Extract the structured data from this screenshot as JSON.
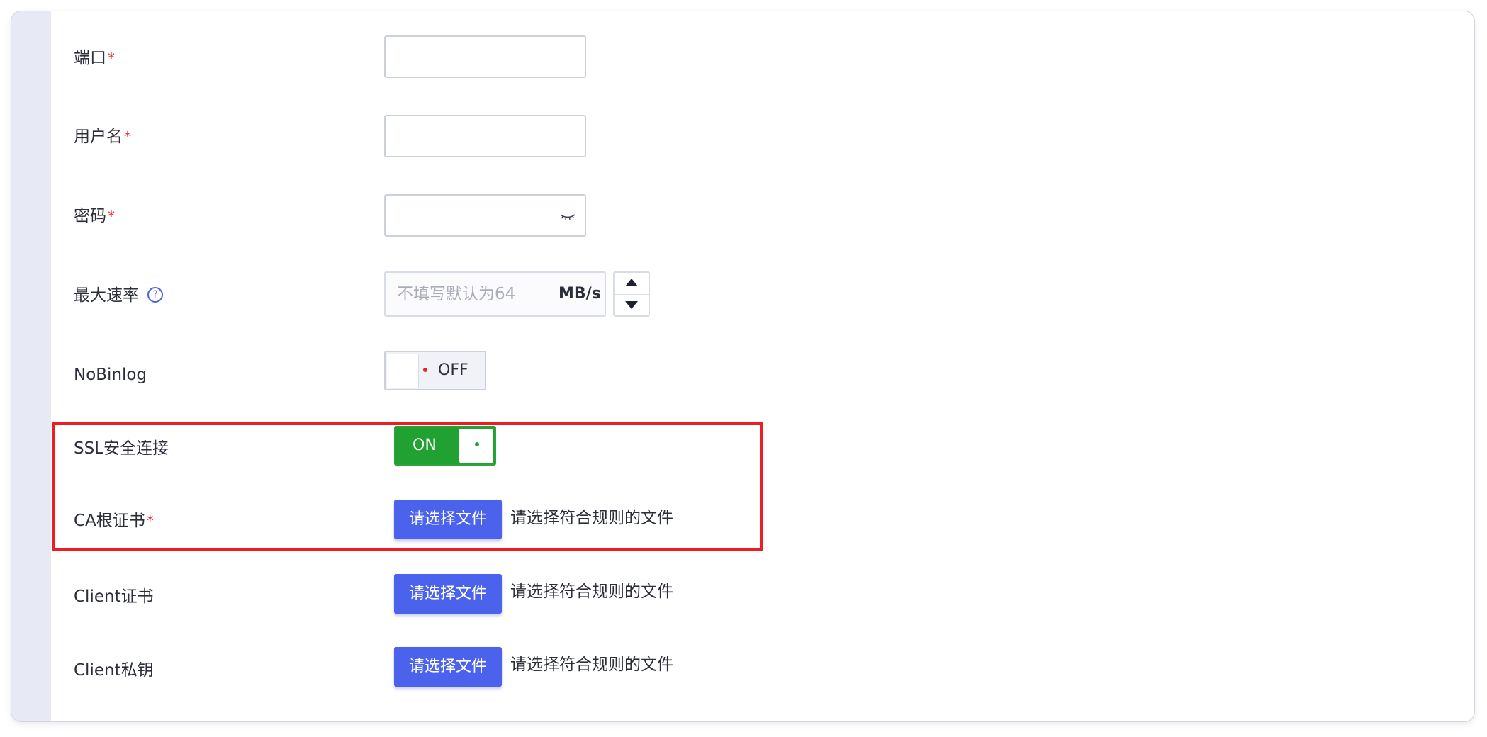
{
  "form": {
    "port": {
      "label": "端口",
      "required_mark": "*",
      "value": ""
    },
    "username": {
      "label": "用户名",
      "required_mark": "*",
      "value": ""
    },
    "password": {
      "label": "密码",
      "required_mark": "*",
      "value": "",
      "icon": "eye-closed-icon"
    },
    "max_rate": {
      "label": "最大速率",
      "help_icon": "question-circle-icon",
      "help_glyph": "?",
      "placeholder": "不填写默认为64",
      "unit": "MB/s",
      "stepper_icons": [
        "caret-up-icon",
        "caret-down-icon"
      ]
    },
    "nobinlog": {
      "label": "NoBinlog",
      "toggle_text": "OFF",
      "state": "off"
    },
    "ssl": {
      "label": "SSL安全连接",
      "toggle_text": "ON",
      "state": "on"
    },
    "ca_cert": {
      "label": "CA根证书",
      "required_mark": "*",
      "button_label": "请选择文件",
      "hint": "请选择符合规则的文件"
    },
    "client_cert": {
      "label": "Client证书",
      "button_label": "请选择文件",
      "hint": "请选择符合规则的文件"
    },
    "client_key": {
      "label": "Client私钥",
      "button_label": "请选择文件",
      "hint": "请选择符合规则的文件"
    }
  },
  "colors": {
    "accent": "#4b62ec",
    "toggle_on": "#21a132",
    "required": "#e5252a",
    "highlight_box": "#ee1c23"
  }
}
